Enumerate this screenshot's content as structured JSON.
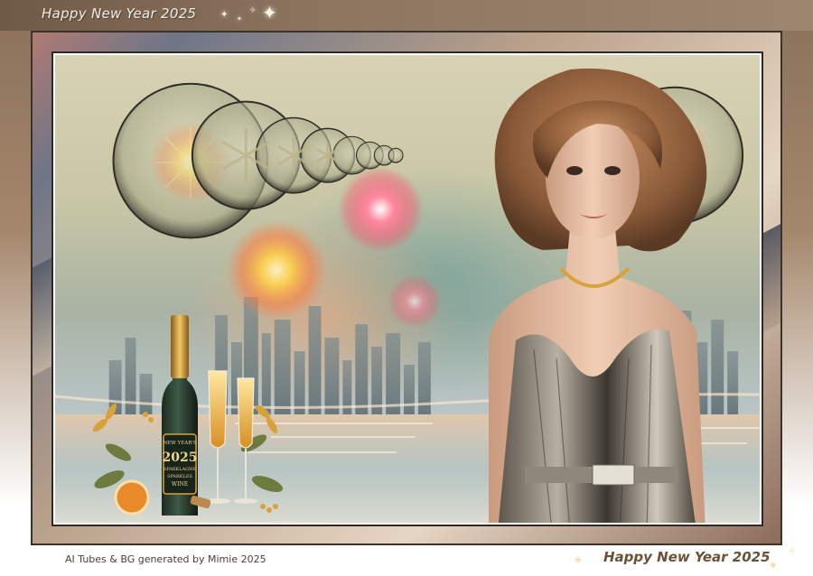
{
  "header": {
    "title": "Happy New Year 2025"
  },
  "footer": {
    "credit": "AI Tubes & BG generated by Mimie 2025",
    "title": "Happy New Year 2025"
  },
  "bottle_label": {
    "line1": "NEW YEAR'S",
    "year": "2025",
    "line2": "SPARKLAGNE",
    "line3": "SPARKLES",
    "line4": "WINE"
  },
  "colors": {
    "frame_brown": "#8a715a",
    "gold": "#d8a23a",
    "firework_pink": "#ff6f8a",
    "firework_gold": "#ffd24a"
  }
}
